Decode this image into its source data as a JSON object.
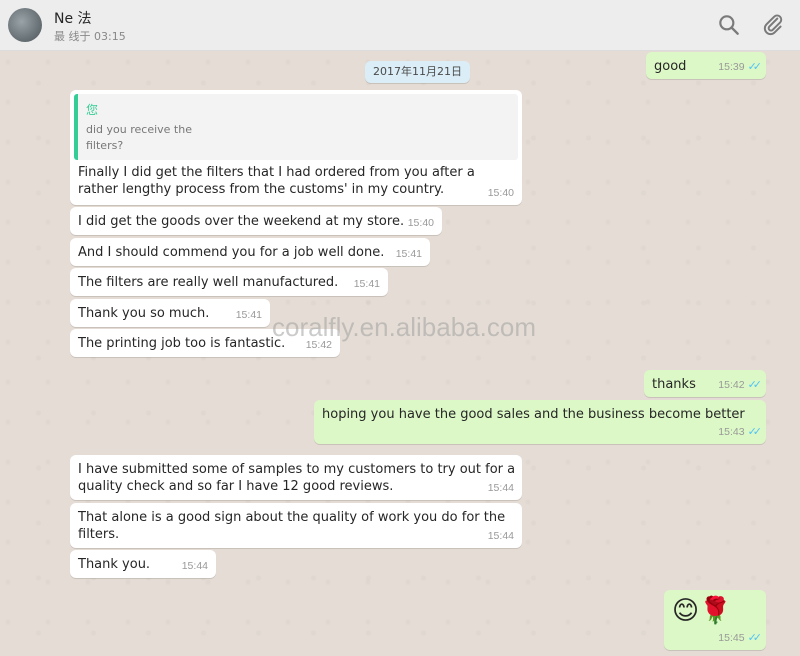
{
  "header": {
    "contact_name": "Ne   法",
    "last_seen": "最        线于      03:15",
    "search_icon": "search-icon",
    "attach_icon": "paperclip-icon"
  },
  "date_separator": "2017年11月21日",
  "messages": [
    {
      "dir": "out",
      "text": "good",
      "time": "15:39",
      "ticks": "✓✓"
    },
    {
      "dir": "in",
      "quote_author": "您",
      "quote_text": "did you receive the filters?",
      "text": "Finally I did get the filters that I had ordered from you after a rather lengthy process from the customs' in my country.",
      "time": "15:40"
    },
    {
      "dir": "in",
      "text": "I did get the goods over the weekend at my store.",
      "time": "15:40"
    },
    {
      "dir": "in",
      "text": "And I should commend you for a job well done.",
      "time": "15:41"
    },
    {
      "dir": "in",
      "text": "The filters are really well manufactured.",
      "time": "15:41"
    },
    {
      "dir": "in",
      "text": "Thank you so much.",
      "time": "15:41"
    },
    {
      "dir": "in",
      "text": "The printing job too is fantastic.",
      "time": "15:42"
    },
    {
      "dir": "out",
      "text": "thanks",
      "time": "15:42",
      "ticks": "✓✓"
    },
    {
      "dir": "out",
      "text": "hoping you have the good sales and the business become better",
      "time": "15:43",
      "ticks": "✓✓"
    },
    {
      "dir": "in",
      "text": "I have submitted some of samples to my customers to try out for a quality check and so far I have 12 good reviews.",
      "time": "15:44"
    },
    {
      "dir": "in",
      "text": "That alone is a good sign about the quality of work you do for the filters.",
      "time": "15:44"
    },
    {
      "dir": "in",
      "text": "Thank you.",
      "time": "15:44"
    },
    {
      "dir": "out",
      "text": "😊🌹",
      "time": "15:45",
      "ticks": "✓✓"
    }
  ],
  "watermark": "coralfly.en.alibaba.com",
  "colors": {
    "incoming": "#ffffff",
    "outgoing": "#dcf8c6",
    "background": "#e5ddd5",
    "quote_accent": "#35cd96",
    "read_ticks": "#4fc3f7"
  }
}
